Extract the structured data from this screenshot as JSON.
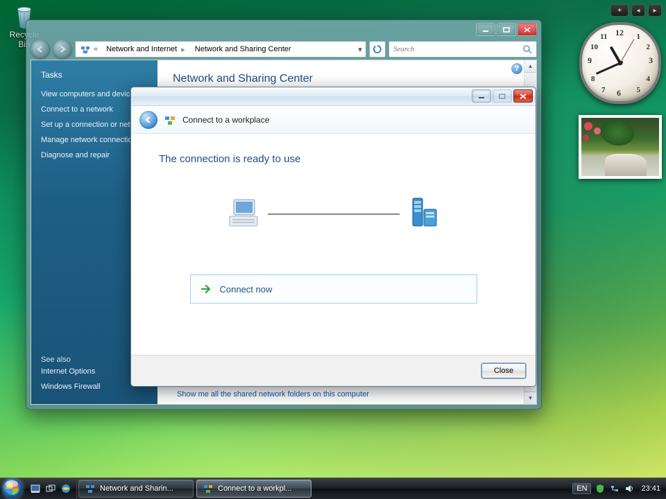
{
  "desktop": {
    "recycle_bin_label": "Recycle Bin"
  },
  "gadgets": {
    "clock_time": "23:41",
    "photo_caption": ""
  },
  "explorer": {
    "breadcrumbs": {
      "root_icon": "network-sharing-center-icon",
      "segment1": "Network and Internet",
      "segment2": "Network and Sharing Center"
    },
    "search_placeholder": "Search",
    "page_title": "Network and Sharing Center",
    "tasks_header": "Tasks",
    "tasks": [
      "View computers and devices",
      "Connect to a network",
      "Set up a connection or network",
      "Manage network connections",
      "Diagnose and repair"
    ],
    "see_also_header": "See also",
    "see_also": [
      "Internet Options",
      "Windows Firewall"
    ],
    "footer_link": "Show me all the shared network folders on this computer"
  },
  "wizard": {
    "title": "Connect to a workplace",
    "heading": "The connection is ready to use",
    "connect_now": "Connect now",
    "close_label": "Close"
  },
  "taskbar": {
    "task1": "Network and Sharin...",
    "task2": "Connect to a workpl...",
    "lang": "EN",
    "time": "23:41"
  }
}
